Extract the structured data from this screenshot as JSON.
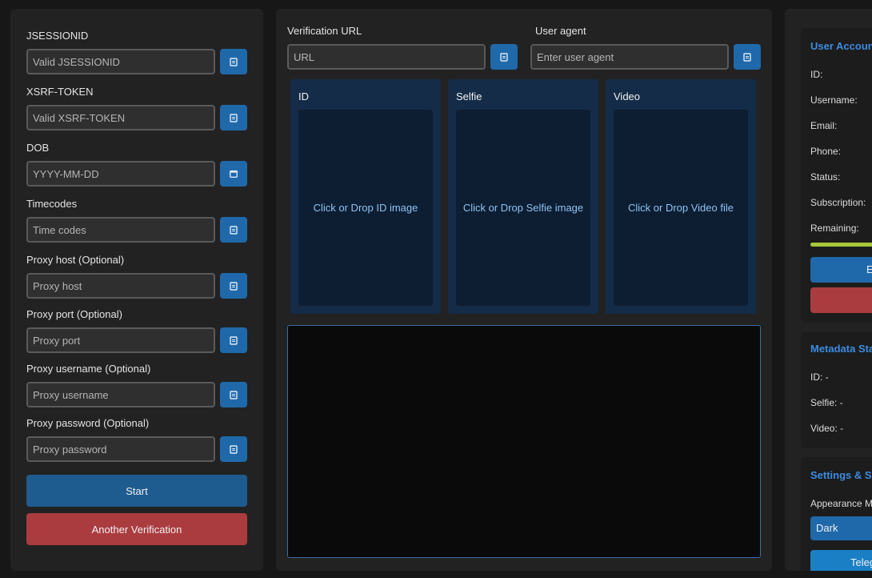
{
  "left_form": {
    "fields": [
      {
        "label": "JSESSIONID",
        "placeholder": "Valid JSESSIONID",
        "icon": "clipboard-icon"
      },
      {
        "label": "XSRF-TOKEN",
        "placeholder": "Valid XSRF-TOKEN",
        "icon": "clipboard-icon"
      },
      {
        "label": "DOB",
        "placeholder": "YYYY-MM-DD",
        "icon": "calendar-icon"
      },
      {
        "label": "Timecodes",
        "placeholder": "Time codes",
        "icon": "clipboard-icon"
      },
      {
        "label": "Proxy host (Optional)",
        "placeholder": "Proxy host",
        "icon": "clipboard-icon"
      },
      {
        "label": "Proxy port (Optional)",
        "placeholder": "Proxy port",
        "icon": "clipboard-icon"
      },
      {
        "label": "Proxy username (Optional)",
        "placeholder": "Proxy username",
        "icon": "clipboard-icon"
      },
      {
        "label": "Proxy password (Optional)",
        "placeholder": "Proxy password",
        "icon": "clipboard-icon"
      }
    ],
    "start_label": "Start",
    "another_label": "Another Verification"
  },
  "center": {
    "verification_url_label": "Verification URL",
    "verification_url_placeholder": "URL",
    "user_agent_label": "User agent",
    "user_agent_placeholder": "Enter user agent",
    "drop_cards": [
      {
        "title": "ID",
        "hint": "Click or Drop ID image"
      },
      {
        "title": "Selfie",
        "hint": "Click or Drop Selfie image"
      },
      {
        "title": "Video",
        "hint": "Click or Drop Video file"
      }
    ]
  },
  "right": {
    "account": {
      "title": "User Account",
      "rows": [
        "ID:",
        "Username:",
        "Email:",
        "Phone:",
        "Status:",
        "Subscription:",
        "Remaining:"
      ],
      "remaining_fraction": 1.0,
      "blue_button_label": "E"
    },
    "metadata": {
      "title": "Metadata Status",
      "rows": [
        "ID: -",
        "Selfie: -",
        "Video: -"
      ]
    },
    "settings": {
      "title": "Settings & Support",
      "appearance_label": "Appearance Mode",
      "appearance_value": "Dark",
      "bottom_button_label": "Telegram"
    }
  },
  "colors": {
    "accent_blue": "#1f69aa",
    "primary_button": "#1e5b8f",
    "danger": "#aa3c3f",
    "title_blue": "#3c8be0",
    "progress": "#a8c83a"
  }
}
